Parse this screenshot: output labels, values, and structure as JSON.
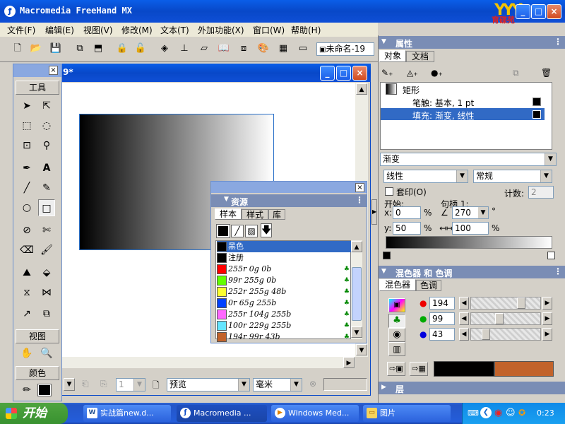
{
  "app": {
    "title": "Macromedia FreeHand MX",
    "logo_text": "育碟苑"
  },
  "menu": [
    "文件(F)",
    "编辑(E)",
    "视图(V)",
    "修改(M)",
    "文本(T)",
    "外加功能(X)",
    "窗口(W)",
    "帮助(H)"
  ],
  "toolbar": {
    "doc_name": "未命名-19"
  },
  "document": {
    "title_suffix": "9*"
  },
  "tools_panel": {
    "title": "工具",
    "view_title": "视图",
    "color_title": "颜色"
  },
  "bottom_bar": {
    "page_value": "1",
    "preview": "预览",
    "units": "毫米"
  },
  "props": {
    "title": "属性",
    "tabs": [
      "对象",
      "文档"
    ],
    "object_name": "矩形",
    "stroke_row": "笔触: 基本, 1 pt",
    "fill_row": "填充: 渐变, 线性",
    "fill_type": "渐变",
    "gradient_kind": "线性",
    "mode": "常规",
    "overprint": "套印(O)",
    "count_label": "计数:",
    "count_value": "2",
    "start_label": "开始:",
    "handle_label": "句柄 1:",
    "x_label": "x:",
    "x_value": "0",
    "y_label": "y:",
    "y_value": "50",
    "pct": "%",
    "angle_value": "270",
    "degree": "°",
    "length_value": "100"
  },
  "mixer": {
    "title": "混色器 和 色调",
    "tabs": [
      "混色器",
      "色调"
    ],
    "r": "194",
    "g": "99",
    "b": "43",
    "r_level": 0.76,
    "g_level": 0.39,
    "b_level": 0.17,
    "swatch_left": "#000000",
    "swatch_right": "#c2632b"
  },
  "layers": {
    "title": "层"
  },
  "assets": {
    "title": "资源",
    "tabs": [
      "样本",
      "样式",
      "库"
    ],
    "swatches": [
      {
        "name": "黑色",
        "color": "#000000",
        "italic": false
      },
      {
        "name": "注册",
        "color": "#000000",
        "italic": false
      },
      {
        "name": "255r 0g 0b",
        "color": "#ff0000",
        "italic": true
      },
      {
        "name": "99r 255g 0b",
        "color": "#63ff00",
        "italic": true
      },
      {
        "name": "252r 255g 48b",
        "color": "#fcff30",
        "italic": true
      },
      {
        "name": "0r 65g 255b",
        "color": "#0041ff",
        "italic": true
      },
      {
        "name": "255r 104g 255b",
        "color": "#ff68ff",
        "italic": true
      },
      {
        "name": "100r 229g 255b",
        "color": "#64e5ff",
        "italic": true
      },
      {
        "name": "194r 99r 43b",
        "color": "#c2632b",
        "italic": true
      }
    ]
  },
  "taskbar": {
    "start": "开始",
    "tasks": [
      "实战篇new.d...",
      "Macromedia ...",
      "Windows Med...",
      "图片"
    ],
    "time": "0:23"
  }
}
